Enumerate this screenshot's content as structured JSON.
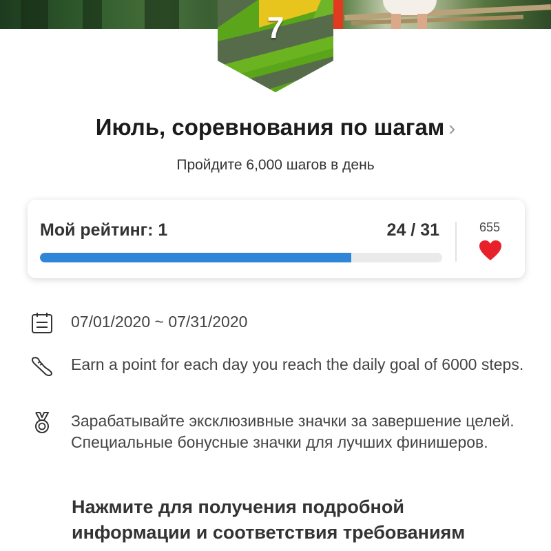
{
  "badge": {
    "number": "7"
  },
  "challenge": {
    "title": "Июль, соревнования по шагам",
    "subtitle": "Пройдите 6,000 шагов в день"
  },
  "rating": {
    "label": "Мой рейтинг: 1",
    "progress_text": "24 / 31",
    "progress_fraction": 0.774,
    "likes": "655"
  },
  "details": {
    "dates": "07/01/2020 ~ 07/31/2020",
    "points_text": "Earn a point for each day you reach the daily goal of 6000 steps.",
    "badges_text": "Зарабатывайте эксклюзивные значки за завершение целей. Специальные бонусные значки для лучших финишеров."
  },
  "cta": {
    "text": "Нажмите для получения подробной информации и соответствия требованиям"
  },
  "icons": {
    "title_chevron": "chevron-right-icon",
    "likes": "heart-icon",
    "dates": "calendar-icon",
    "points": "sneaker-icon",
    "badges": "medal-icon"
  },
  "colors": {
    "progress_fill": "#2f86d8",
    "heart": "#e8202a",
    "badge_green": "#5aa51a",
    "badge_dark": "#556b4a",
    "badge_yellow": "#e8c51c"
  }
}
